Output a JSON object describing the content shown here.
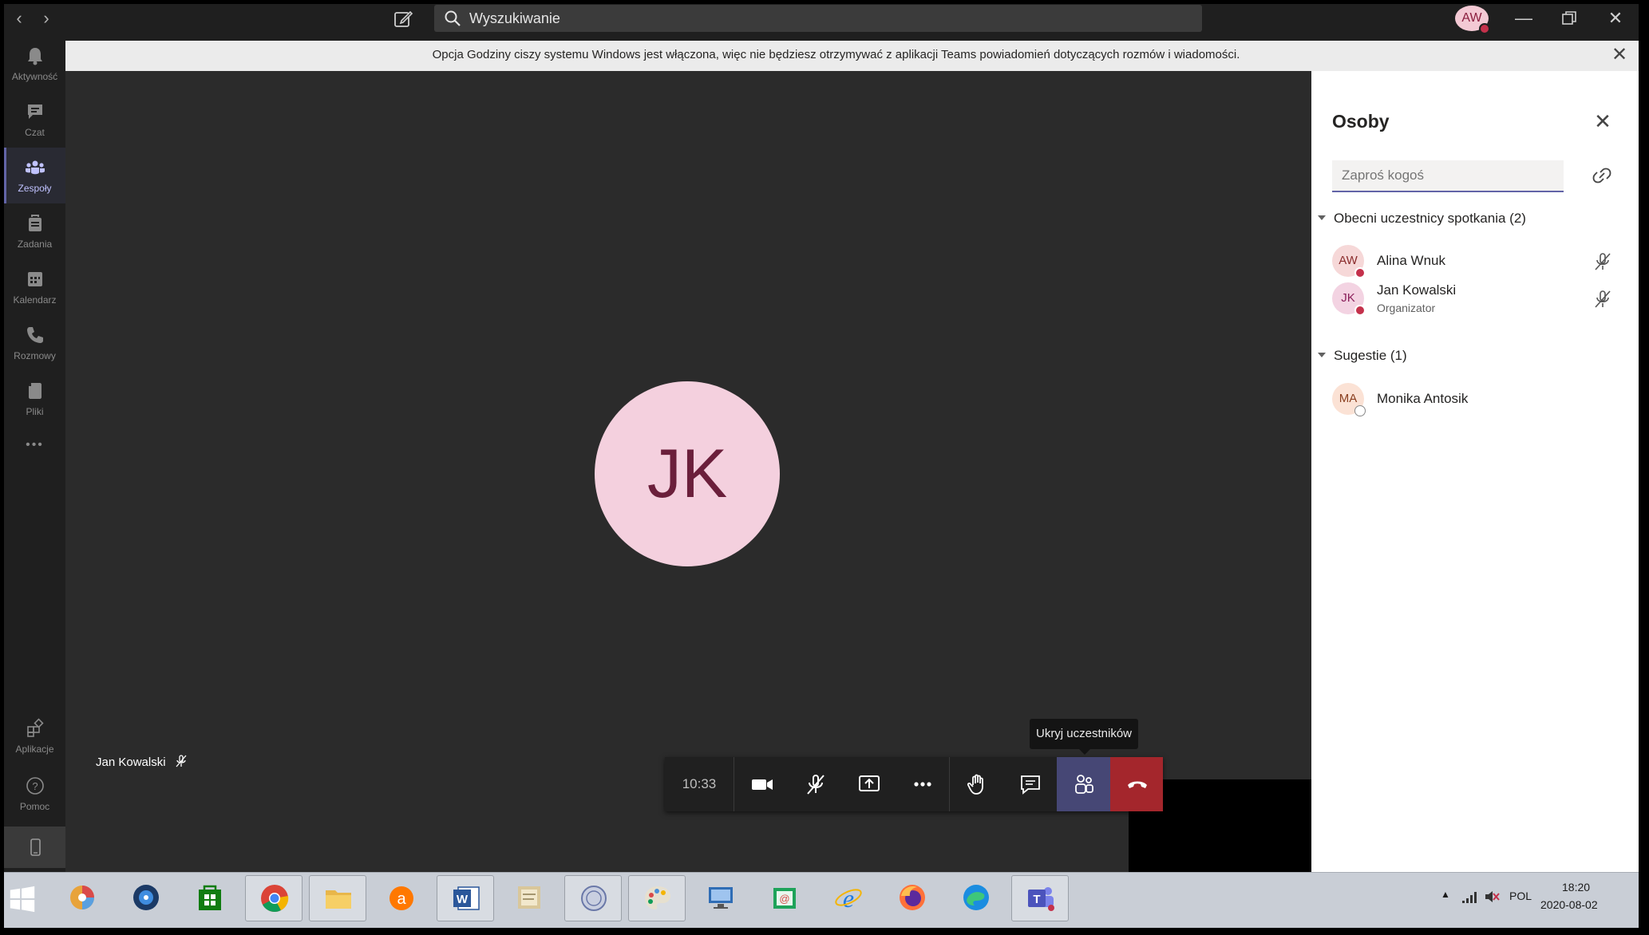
{
  "titlebar": {
    "search_placeholder": "Wyszukiwanie",
    "user_initials": "AW"
  },
  "banner": {
    "text": "Opcja Godziny ciszy systemu Windows jest włączona, więc nie będziesz otrzymywać z aplikacji Teams powiadomień dotyczących rozmów i wiadomości."
  },
  "rail": {
    "items": [
      {
        "label": "Aktywność",
        "icon": "bell-icon"
      },
      {
        "label": "Czat",
        "icon": "chat-icon"
      },
      {
        "label": "Zespoły",
        "icon": "teams-icon"
      },
      {
        "label": "Zadania",
        "icon": "tasks-icon"
      },
      {
        "label": "Kalendarz",
        "icon": "calendar-icon"
      },
      {
        "label": "Rozmowy",
        "icon": "phone-icon"
      },
      {
        "label": "Pliki",
        "icon": "files-icon"
      }
    ],
    "more": "•••",
    "apps_label": "Aplikacje",
    "help_label": "Pomoc"
  },
  "stage": {
    "participant_initials": "JK",
    "participant_name": "Jan Kowalski"
  },
  "controls": {
    "timer": "10:33",
    "tooltip": "Ukryj uczestników"
  },
  "panel": {
    "title": "Osoby",
    "invite_placeholder": "Zaproś kogoś",
    "current_section": "Obecni uczestnicy spotkania (2)",
    "suggestions_section": "Sugestie (1)",
    "participants": [
      {
        "initials": "AW",
        "name": "Alina Wnuk",
        "role": ""
      },
      {
        "initials": "JK",
        "name": "Jan Kowalski",
        "role": "Organizator"
      }
    ],
    "suggestions": [
      {
        "initials": "MA",
        "name": "Monika Antosik"
      }
    ]
  },
  "taskbar": {
    "language": "POL",
    "time": "18:20",
    "date": "2020-08-02"
  },
  "colors": {
    "accent": "#6264a7",
    "hangup": "#a4262c",
    "busy": "#c4314b"
  }
}
